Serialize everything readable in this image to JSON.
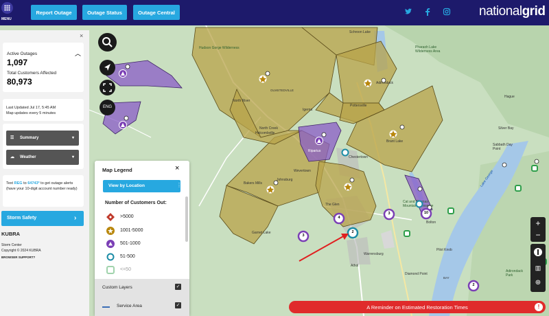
{
  "header": {
    "menu_label": "MENU",
    "buttons": [
      "Report Outage",
      "Outage Status",
      "Outage Central"
    ],
    "brand_light": "national",
    "brand_bold": "grid",
    "social_icons": [
      "twitter-icon",
      "facebook-icon",
      "instagram-icon"
    ]
  },
  "sidebar": {
    "active_outages_label": "Active Outages",
    "active_outages_value": "1,097",
    "total_customers_label": "Total Customers Affected",
    "total_customers_value": "80,973",
    "last_updated": "Last Updated  Jul 17, 5:45 AM",
    "update_frequency": "Map updates every 5 minutes",
    "dropdowns": [
      "Summary",
      "Weather"
    ],
    "text_alert_prefix": "Text ",
    "text_alert_keyword": "REG",
    "text_alert_to": " to ",
    "text_alert_number": "64743*",
    "text_alert_suffix": " to get outage alerts (have your 10-digit account number ready)",
    "storm_safety": "Storm Safety",
    "kubra": "KUBRA",
    "storm_center": "Storm Center",
    "copyright": "Copyright © 2024 KUBRA",
    "browser_support": "BROWSER SUPPORT?"
  },
  "map_controls": {
    "language": "ENG",
    "zoom_in": "+",
    "zoom_out": "−"
  },
  "legend": {
    "title": "Map Legend",
    "view_by_location": "View by Location",
    "customers_out_title": "Number of Customers Out:",
    "items": [
      {
        "label": ">5000",
        "color": "#c0392b"
      },
      {
        "label": "1001-5000",
        "color": "#b8860b"
      },
      {
        "label": "501-1000",
        "color": "#7b3fb5"
      },
      {
        "label": "51-500",
        "color": "#1b8ca6"
      },
      {
        "label": "<=50",
        "color": "#2e9e4a"
      }
    ],
    "custom_layers": "Custom Layers",
    "service_area": "Service Area"
  },
  "map_labels": {
    "schroon_lake": "Schroon Lake",
    "pharaoh_lake": "Pharaoh Lake Wilderness Area",
    "hudson_gorge": "Hudson Gorge Wilderness",
    "olmstedville": "OLMSTEDVILLE",
    "adirondack": "Adirondack",
    "north_river": "North River",
    "igerna": "Igerna",
    "pottersville": "Pottersville",
    "north_creek": "North Creek",
    "holcombville": "Holcombville",
    "ripanus": "Riparius",
    "chestertown": "Chestertown",
    "brant_lake": "Brant Lake",
    "hague": "Hague",
    "silver_bay": "Silver Bay",
    "sabbath_day": "Sabbath Day Point",
    "wevertown": "Wevertown",
    "johnsburg": "Johnsburg",
    "bakers_mills": "Bakers Mills",
    "the_glen": "The Glen",
    "garnet_lake": "Garnet Lake",
    "cat_thomas": "Cat and Thomas Mountains Preserve",
    "bolton": "Bolton",
    "lake_george": "Lake George",
    "warrensburg": "Warrensburg",
    "pilot_knob": "Pilot Knob",
    "diamond_point": "Diamond Point",
    "adirondack_park": "Adirondack Park",
    "athol": "Athol",
    "bay": "BAY",
    "area": "Area"
  },
  "clusters": [
    "4",
    "3",
    "2",
    "3",
    "10",
    "2"
  ],
  "banner": "A Reminder on Estimated Restoration Times",
  "colors": {
    "header": "#1d1a6b",
    "button": "#27a8e0",
    "outage_gold": "#b8a34a",
    "outage_purple": "#8a5cc8",
    "alert": "#e02b2b"
  }
}
